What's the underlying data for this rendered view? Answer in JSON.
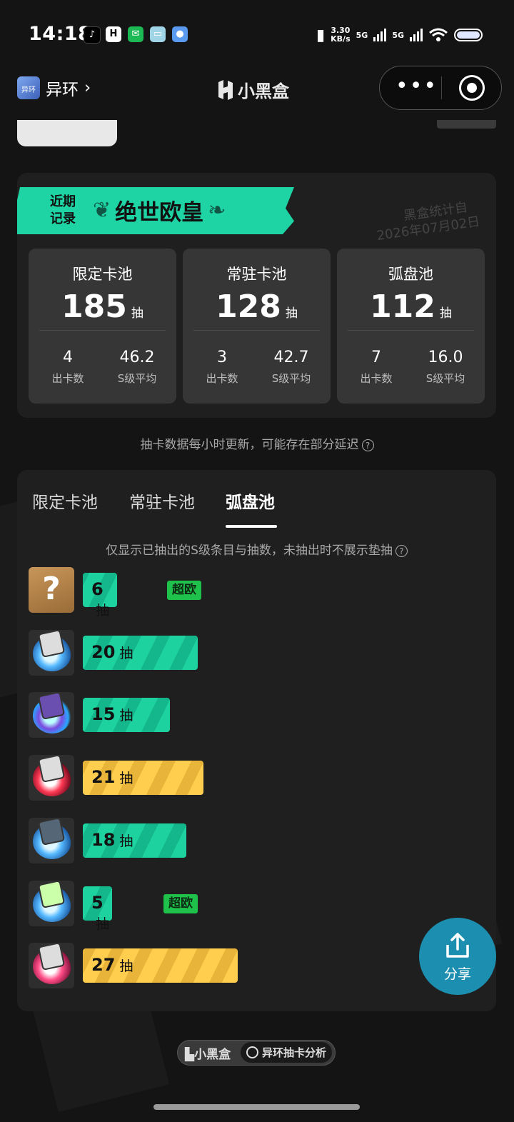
{
  "status_bar": {
    "time": "14:18",
    "speed_value": "3.30",
    "speed_unit": "KB/s",
    "net1": "5G",
    "net2": "5G"
  },
  "header": {
    "game_name": "异环",
    "game_logo_text": "异环",
    "brand": "小黑盒"
  },
  "summary": {
    "ribbon_label": "近期\n记录",
    "ribbon_title": "绝世欧皇",
    "stamp_line1": "黑盒统计自",
    "stamp_line2": "2026年07月02日",
    "stats": [
      {
        "name": "限定卡池",
        "count": "185",
        "unit": "抽",
        "cards": "4",
        "cards_label": "出卡数",
        "avg": "46.2",
        "avg_label": "S级平均"
      },
      {
        "name": "常驻卡池",
        "count": "128",
        "unit": "抽",
        "cards": "3",
        "cards_label": "出卡数",
        "avg": "42.7",
        "avg_label": "S级平均"
      },
      {
        "name": "弧盘池",
        "count": "112",
        "unit": "抽",
        "cards": "7",
        "cards_label": "出卡数",
        "avg": "16.0",
        "avg_label": "S级平均"
      }
    ]
  },
  "note": "抽卡数据每小时更新，可能存在部分延迟",
  "detail": {
    "tabs": [
      "限定卡池",
      "常驻卡池",
      "弧盘池"
    ],
    "active_tab": "弧盘池",
    "subtitle": "仅显示已抽出的S级条目与抽数，未抽出时不展示垫抽",
    "unit": "抽",
    "rows": [
      {
        "count": "6",
        "color": "green",
        "badge": "超欧",
        "icon": "mystery-question-icon",
        "fill": 0.22
      },
      {
        "count": "20",
        "color": "green",
        "badge": "",
        "icon": "blue-disc-icon",
        "fill": 0.74
      },
      {
        "count": "15",
        "color": "green",
        "badge": "",
        "icon": "purple-disc-icon",
        "fill": 0.56
      },
      {
        "count": "21",
        "color": "gold",
        "badge": "",
        "icon": "red-disc-icon",
        "fill": 0.78
      },
      {
        "count": "18",
        "color": "green",
        "badge": "",
        "icon": "blue-disc-icon",
        "fill": 0.67
      },
      {
        "count": "5",
        "color": "green",
        "badge": "超欧",
        "icon": "blue-disc-icon",
        "fill": 0.19
      },
      {
        "count": "27",
        "color": "gold",
        "badge": "",
        "icon": "pink-disc-icon",
        "fill": 1.0
      }
    ]
  },
  "share_label": "分享",
  "footer": {
    "brand": "小黑盒",
    "tool": "异环抽卡分析"
  }
}
